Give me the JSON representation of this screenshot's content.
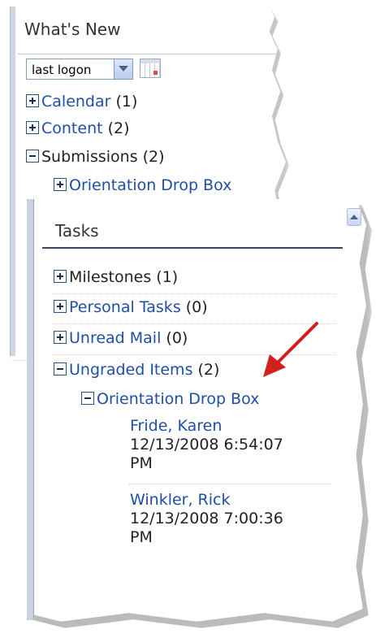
{
  "whats_new": {
    "title": "What's New",
    "filter_value": "last logon",
    "items": [
      {
        "label": "Calendar",
        "count": "(1)"
      },
      {
        "label": "Content",
        "count": "(2)"
      },
      {
        "label": "Submissions",
        "count": "(2)"
      },
      {
        "label": "Orientation Drop Box"
      }
    ]
  },
  "tasks": {
    "title": "Tasks",
    "items": [
      {
        "label": "Milestones",
        "count": "(1)"
      },
      {
        "label": "Personal Tasks",
        "count": "(0)"
      },
      {
        "label": "Unread Mail",
        "count": "(0)"
      },
      {
        "label": "Ungraded Items",
        "count": "(2)"
      }
    ],
    "subfolder": "Orientation Drop Box",
    "submissions": [
      {
        "name": "Fride, Karen",
        "date": "12/13/2008 6:54:07",
        "time_suffix": "PM"
      },
      {
        "name": "Winkler, Rick",
        "date": "12/13/2008 7:00:36",
        "time_suffix": "PM"
      }
    ]
  },
  "colors": {
    "link": "#1f4ea8",
    "arrow": "#d21f1f"
  }
}
